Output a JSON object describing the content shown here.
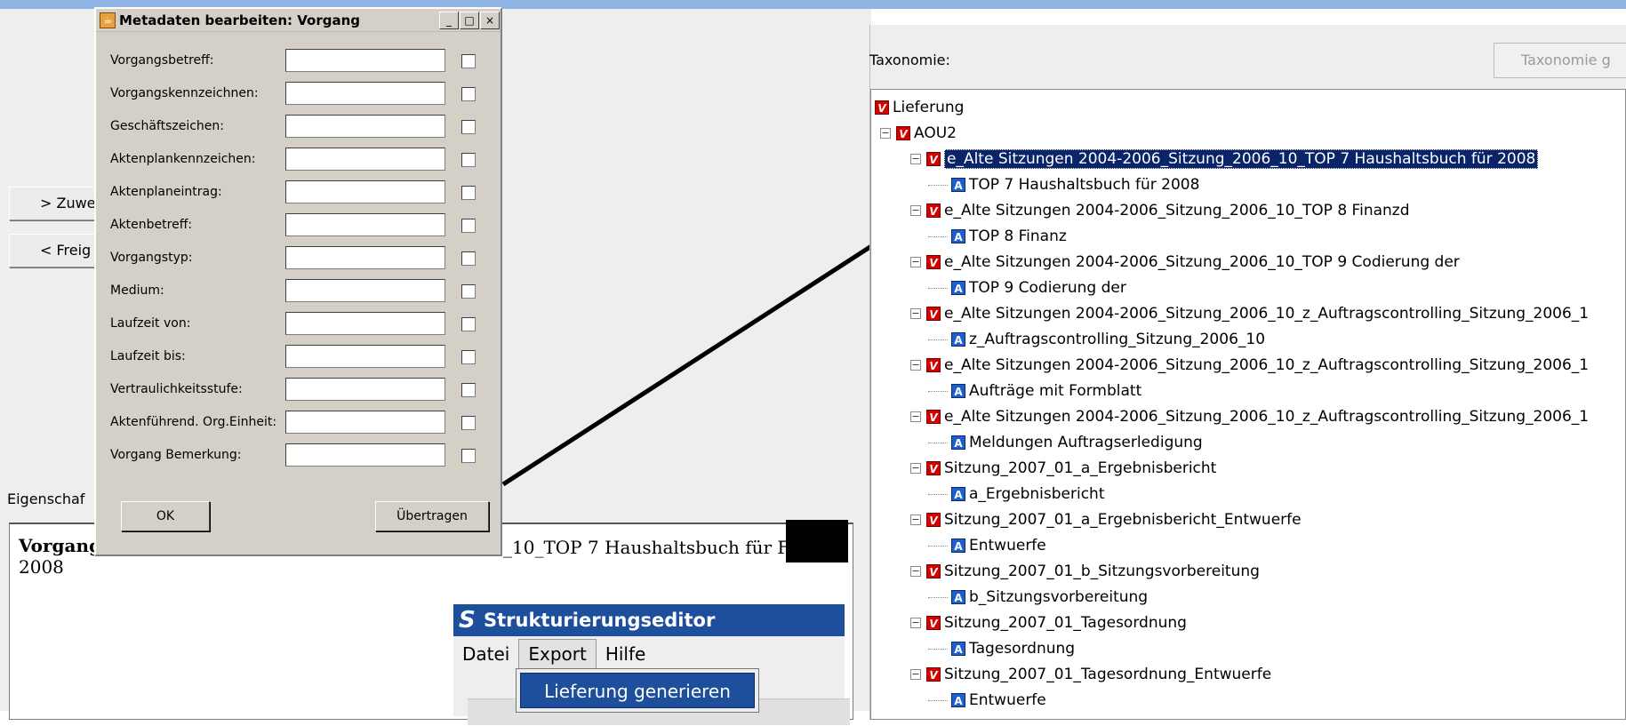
{
  "left_panel": {
    "button_zuweisen": "> Zuwe",
    "button_freigeben": "< Freig",
    "eigenschaften_label": "Eigenschaf",
    "doc_title": "Vorgang",
    "doc_tail": "_10_TOP 7 Haushaltsbuch für F",
    "doc_year": "2008"
  },
  "dialog": {
    "title": "Metadaten bearbeiten: Vorgang",
    "fields": [
      {
        "label": "Vorgangsbetreff:",
        "value": ""
      },
      {
        "label": "Vorgangskennzeichnen:",
        "value": ""
      },
      {
        "label": "Geschäftszeichen:",
        "value": ""
      },
      {
        "label": "Aktenplankennzeichen:",
        "value": ""
      },
      {
        "label": "Aktenplaneintrag:",
        "value": ""
      },
      {
        "label": "Aktenbetreff:",
        "value": ""
      },
      {
        "label": "Vorgangstyp:",
        "value": ""
      },
      {
        "label": "Medium:",
        "value": ""
      },
      {
        "label": "Laufzeit von:",
        "value": ""
      },
      {
        "label": "Laufzeit bis:",
        "value": ""
      },
      {
        "label": "Vertraulichkeitsstufe:",
        "value": ""
      },
      {
        "label": "Aktenführend. Org.Einheit:",
        "value": ""
      },
      {
        "label": "Vorgang Bemerkung:",
        "value": ""
      }
    ],
    "ok_label": "OK",
    "transfer_label": "Übertragen",
    "window_buttons": [
      "_",
      "□",
      "×"
    ]
  },
  "editor": {
    "logo": "S",
    "title": "Strukturierungseditor",
    "menu": [
      "Datei",
      "Export",
      "Hilfe"
    ],
    "active_menu": "Export",
    "dropdown_item": "Lieferung generieren"
  },
  "taxonomy": {
    "label": "Taxonomie:",
    "button": "Taxonomie g",
    "tree": [
      {
        "level": 0,
        "type": "V",
        "text": "Lieferung",
        "expander": ""
      },
      {
        "level": 1,
        "type": "V",
        "text": "AOU2",
        "expander": "−"
      },
      {
        "level": 2,
        "type": "V",
        "text": "e_Alte Sitzungen 2004-2006_Sitzung_2006_10_TOP 7 Haushaltsbuch für 2008",
        "expander": "−",
        "selected": true
      },
      {
        "level": 3,
        "type": "A",
        "text": "TOP 7 Haushaltsbuch für 2008",
        "expander": ""
      },
      {
        "level": 2,
        "type": "V",
        "text": "e_Alte Sitzungen 2004-2006_Sitzung_2006_10_TOP 8 Finanzd",
        "expander": "−"
      },
      {
        "level": 3,
        "type": "A",
        "text": "TOP 8 Finanz",
        "expander": ""
      },
      {
        "level": 2,
        "type": "V",
        "text": "e_Alte Sitzungen 2004-2006_Sitzung_2006_10_TOP 9 Codierung der",
        "expander": "−"
      },
      {
        "level": 3,
        "type": "A",
        "text": "TOP 9 Codierung der",
        "expander": ""
      },
      {
        "level": 2,
        "type": "V",
        "text": "e_Alte Sitzungen 2004-2006_Sitzung_2006_10_z_Auftragscontrolling_Sitzung_2006_1",
        "expander": "−"
      },
      {
        "level": 3,
        "type": "A",
        "text": "z_Auftragscontrolling_Sitzung_2006_10",
        "expander": ""
      },
      {
        "level": 2,
        "type": "V",
        "text": "e_Alte Sitzungen 2004-2006_Sitzung_2006_10_z_Auftragscontrolling_Sitzung_2006_1",
        "expander": "−"
      },
      {
        "level": 3,
        "type": "A",
        "text": "Aufträge mit Formblatt",
        "expander": ""
      },
      {
        "level": 2,
        "type": "V",
        "text": "e_Alte Sitzungen 2004-2006_Sitzung_2006_10_z_Auftragscontrolling_Sitzung_2006_1",
        "expander": "−"
      },
      {
        "level": 3,
        "type": "A",
        "text": "Meldungen Auftragserledigung",
        "expander": ""
      },
      {
        "level": 2,
        "type": "V",
        "text": "Sitzung_2007_01_a_Ergebnisbericht",
        "expander": "−"
      },
      {
        "level": 3,
        "type": "A",
        "text": "a_Ergebnisbericht",
        "expander": ""
      },
      {
        "level": 2,
        "type": "V",
        "text": "Sitzung_2007_01_a_Ergebnisbericht_Entwuerfe",
        "expander": "−"
      },
      {
        "level": 3,
        "type": "A",
        "text": "Entwuerfe",
        "expander": ""
      },
      {
        "level": 2,
        "type": "V",
        "text": "Sitzung_2007_01_b_Sitzungsvorbereitung",
        "expander": "−"
      },
      {
        "level": 3,
        "type": "A",
        "text": "b_Sitzungsvorbereitung",
        "expander": ""
      },
      {
        "level": 2,
        "type": "V",
        "text": "Sitzung_2007_01_Tagesordnung",
        "expander": "−"
      },
      {
        "level": 3,
        "type": "A",
        "text": "Tagesordnung",
        "expander": ""
      },
      {
        "level": 2,
        "type": "V",
        "text": "Sitzung_2007_01_Tagesordnung_Entwuerfe",
        "expander": "−"
      },
      {
        "level": 3,
        "type": "A",
        "text": "Entwuerfe",
        "expander": ""
      }
    ]
  }
}
